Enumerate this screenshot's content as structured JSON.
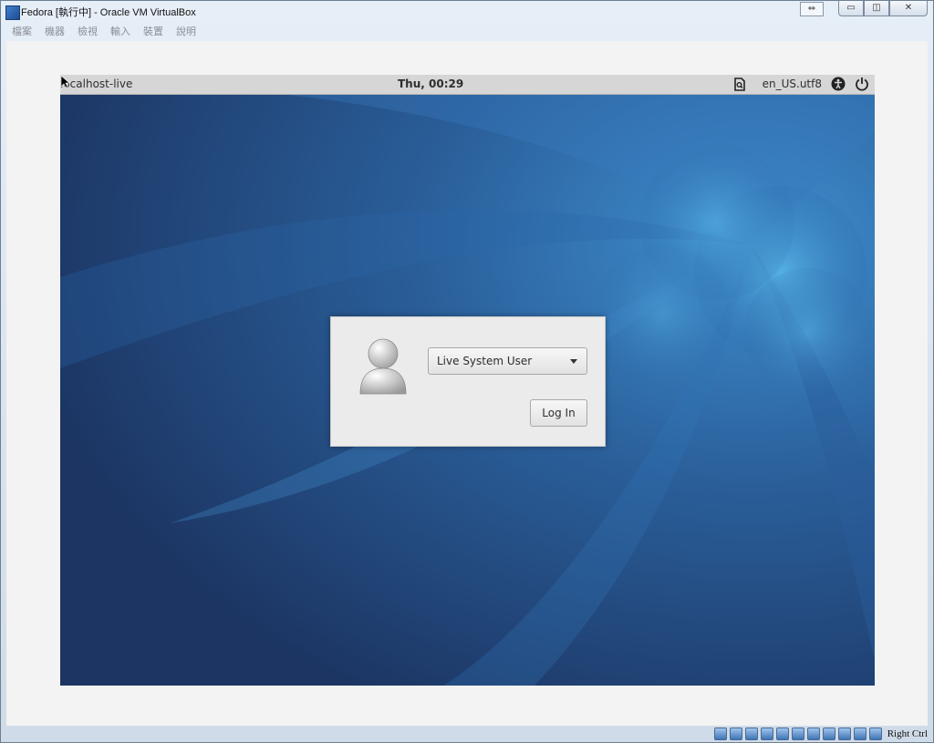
{
  "window": {
    "title": "Fedora [執行中] - Oracle VM VirtualBox",
    "controls": {
      "minimize": "▭",
      "restore": "◫",
      "close": "✕",
      "switch": "⇔"
    }
  },
  "menubar": {
    "items": [
      "檔案",
      "機器",
      "檢視",
      "輸入",
      "裝置",
      "說明"
    ]
  },
  "statusbar": {
    "icons": [
      "hard-disk-icon",
      "optical-drive-icon",
      "audio-icon",
      "usb-icon",
      "shared-folders-icon",
      "display-icon",
      "video-capture-icon",
      "network-icon",
      "cpu-icon",
      "mouse-integration-icon",
      "host-key-icon"
    ],
    "host_key": "Right Ctrl"
  },
  "guest": {
    "topbar": {
      "hostname": "localhost-live",
      "clock": "Thu, 00:29",
      "locale": "en_US.utf8",
      "icons": [
        "keyboard-layout-icon",
        "accessibility-icon",
        "power-icon"
      ]
    },
    "login": {
      "user": "Live System User",
      "login_button": "Log In"
    },
    "colors": {
      "wallpaper_dark": "#1e3a68",
      "wallpaper_light": "#4aa3d8",
      "panel": "#d6d6d6",
      "dialog": "#ebebeb"
    }
  }
}
